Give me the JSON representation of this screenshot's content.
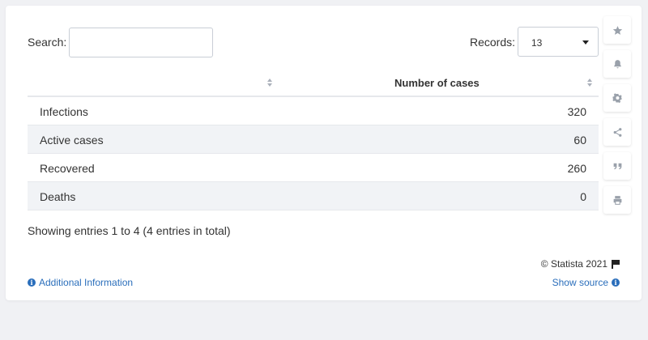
{
  "search": {
    "label": "Search:",
    "value": "",
    "placeholder": ""
  },
  "records": {
    "label": "Records:",
    "selected": "13"
  },
  "table": {
    "columns": [
      "",
      "Number of cases"
    ],
    "rows": [
      {
        "label": "Infections",
        "value": "320"
      },
      {
        "label": "Active cases",
        "value": "60"
      },
      {
        "label": "Recovered",
        "value": "260"
      },
      {
        "label": "Deaths",
        "value": "0"
      }
    ]
  },
  "footer": {
    "entries": "Showing entries 1 to 4 (4 entries in total)",
    "copyright": "© Statista 2021",
    "additional_info": "Additional Information",
    "show_source": "Show source"
  },
  "sidebar_icons": [
    "star-icon",
    "bell-icon",
    "gear-icon",
    "share-icon",
    "quote-icon",
    "print-icon"
  ],
  "colors": {
    "link": "#2a6ebb",
    "row_alt": "#f1f3f6",
    "background": "#f0f1f4"
  }
}
